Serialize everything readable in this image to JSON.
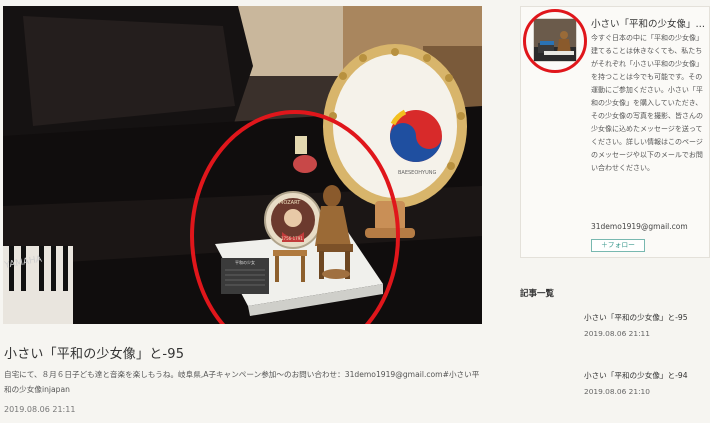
{
  "photo": {
    "alt_subject": "piano-figurine-drum-photo",
    "badge_text": "MOZART",
    "badge_years": "1756-1791",
    "plaque_title": "平和の少女",
    "drum_text": "BAESEOHYUNG",
    "keyboard_brand": "YAMAHA"
  },
  "post": {
    "title": "小さい「平和の少女像」と-95",
    "excerpt": "自宅にて、８月６日子ども達と音楽を楽しもうね。岐阜県,A子キャンペーン参加〜のお問い合わせ：31demo1919@gmail.com#小さい平和の少女像injapan",
    "date": "2019.08.06 21:11"
  },
  "profile": {
    "name": "小さい「平和の少女像」…",
    "bio": "今すぐ日本の中に「平和の少女像」建てることは休きなくても、私たちがそれぞれ「小さい平和の少女像」を持つことは今でも可能です。その運動にご参加ください。小さい「平和の少女像」を購入していただき、その少女像の写真を撮影、皆さんの少女像に込めたメッセージを送ってください。詳しい情報はこのページのメッセージや以下のメールでお問い合わせください。",
    "email": "31demo1919@gmail.com",
    "follow_label": "＋フォロー"
  },
  "article_list": {
    "heading": "記事一覧",
    "items": [
      {
        "title": "小さい「平和の少女像」と-95",
        "date": "2019.08.06 21:11"
      },
      {
        "title": "小さい「平和の少女像」と-94",
        "date": "2019.08.06 21:10"
      }
    ]
  },
  "colors": {
    "annotation_circle": "#e0161b",
    "follow_accent": "#3d9a8f",
    "background": "#f6f5f1"
  }
}
